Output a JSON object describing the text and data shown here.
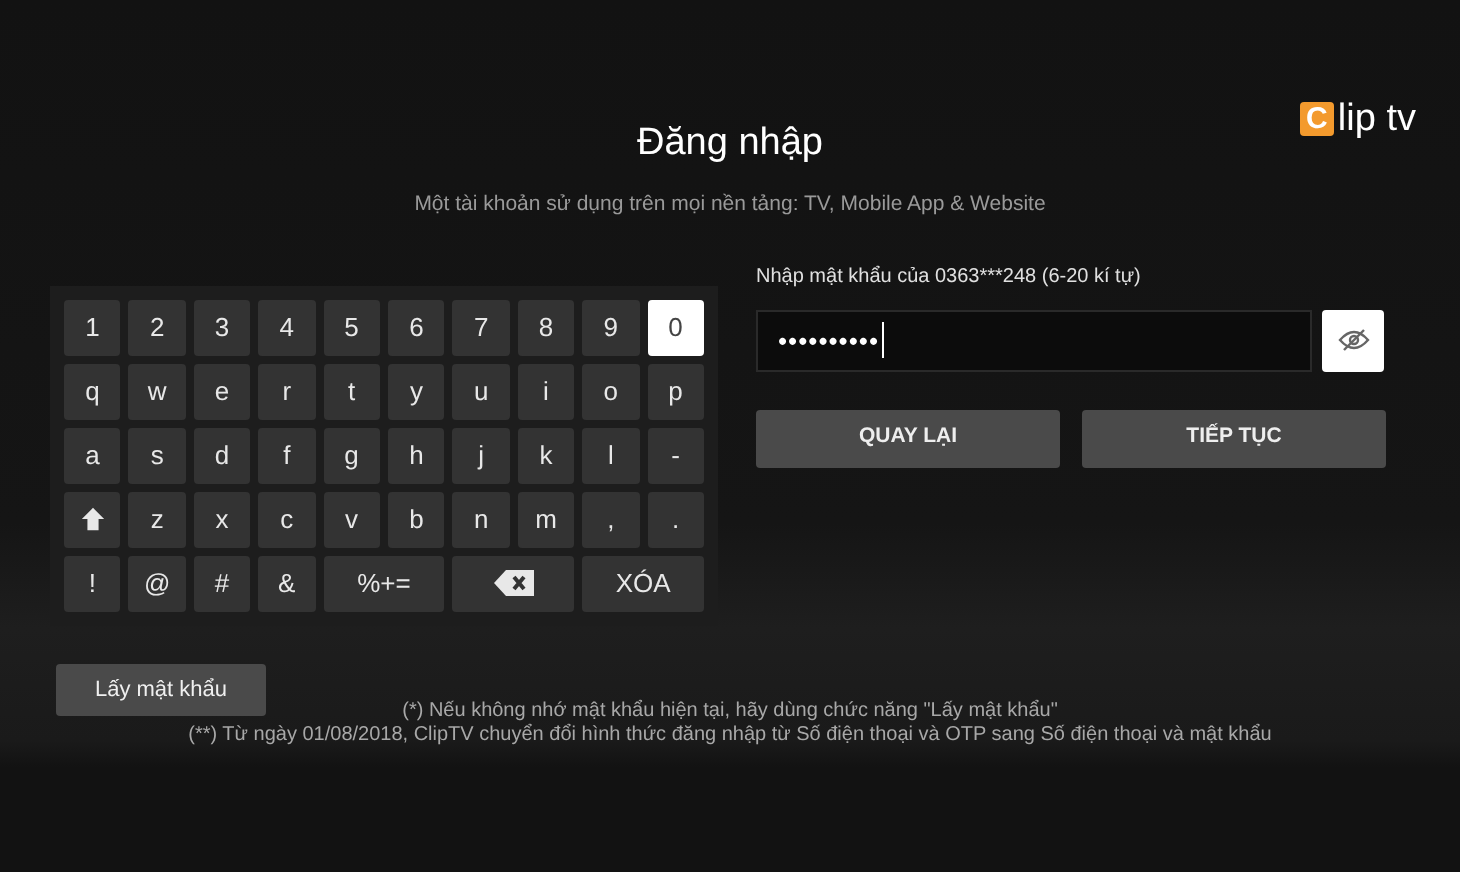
{
  "logo": {
    "badge": "C",
    "text": "lip tv"
  },
  "title": "Đăng nhập",
  "subtitle": "Một tài khoản sử dụng trên mọi nền tảng: TV, Mobile App & Website",
  "keyboard": {
    "rows": [
      [
        {
          "kind": "char",
          "label": "1",
          "selected": false
        },
        {
          "kind": "char",
          "label": "2",
          "selected": false
        },
        {
          "kind": "char",
          "label": "3",
          "selected": false
        },
        {
          "kind": "char",
          "label": "4",
          "selected": false
        },
        {
          "kind": "char",
          "label": "5",
          "selected": false
        },
        {
          "kind": "char",
          "label": "6",
          "selected": false
        },
        {
          "kind": "char",
          "label": "7",
          "selected": false
        },
        {
          "kind": "char",
          "label": "8",
          "selected": false
        },
        {
          "kind": "char",
          "label": "9",
          "selected": false
        },
        {
          "kind": "char",
          "label": "0",
          "selected": true
        }
      ],
      [
        {
          "kind": "char",
          "label": "q",
          "selected": false
        },
        {
          "kind": "char",
          "label": "w",
          "selected": false
        },
        {
          "kind": "char",
          "label": "e",
          "selected": false
        },
        {
          "kind": "char",
          "label": "r",
          "selected": false
        },
        {
          "kind": "char",
          "label": "t",
          "selected": false
        },
        {
          "kind": "char",
          "label": "y",
          "selected": false
        },
        {
          "kind": "char",
          "label": "u",
          "selected": false
        },
        {
          "kind": "char",
          "label": "i",
          "selected": false
        },
        {
          "kind": "char",
          "label": "o",
          "selected": false
        },
        {
          "kind": "char",
          "label": "p",
          "selected": false
        }
      ],
      [
        {
          "kind": "char",
          "label": "a",
          "selected": false
        },
        {
          "kind": "char",
          "label": "s",
          "selected": false
        },
        {
          "kind": "char",
          "label": "d",
          "selected": false
        },
        {
          "kind": "char",
          "label": "f",
          "selected": false
        },
        {
          "kind": "char",
          "label": "g",
          "selected": false
        },
        {
          "kind": "char",
          "label": "h",
          "selected": false
        },
        {
          "kind": "char",
          "label": "j",
          "selected": false
        },
        {
          "kind": "char",
          "label": "k",
          "selected": false
        },
        {
          "kind": "char",
          "label": "l",
          "selected": false
        },
        {
          "kind": "char",
          "label": "-",
          "selected": false
        }
      ],
      [
        {
          "kind": "shift",
          "selected": false
        },
        {
          "kind": "char",
          "label": "z",
          "selected": false
        },
        {
          "kind": "char",
          "label": "x",
          "selected": false
        },
        {
          "kind": "char",
          "label": "c",
          "selected": false
        },
        {
          "kind": "char",
          "label": "v",
          "selected": false
        },
        {
          "kind": "char",
          "label": "b",
          "selected": false
        },
        {
          "kind": "char",
          "label": "n",
          "selected": false
        },
        {
          "kind": "char",
          "label": "m",
          "selected": false
        },
        {
          "kind": "char",
          "label": ",",
          "selected": false
        },
        {
          "kind": "char",
          "label": ".",
          "selected": false
        }
      ],
      [
        {
          "kind": "char",
          "label": "!",
          "selected": false
        },
        {
          "kind": "char",
          "label": "@",
          "selected": false
        },
        {
          "kind": "char",
          "label": "#",
          "selected": false
        },
        {
          "kind": "char",
          "label": "&",
          "selected": false
        },
        {
          "kind": "wide",
          "label": "%+=",
          "selected": false
        },
        {
          "kind": "backspace",
          "selected": false
        },
        {
          "kind": "wide",
          "label": "XÓA",
          "selected": false
        }
      ]
    ]
  },
  "password": {
    "label": "Nhập mật khẩu của 0363***248 (6-20 kí tự)",
    "value": "••••••••••"
  },
  "buttons": [
    "QUAY LẠI",
    "TIẾP TỤC"
  ],
  "forgot_button": "Lấy mật khẩu",
  "notes": [
    "(*) Nếu không nhớ mật khẩu hiện tại, hãy dùng chức năng \"Lấy mật khẩu\"",
    "(**) Từ ngày 01/08/2018, ClipTV chuyển đổi hình thức đăng nhập từ Số điện thoại và OTP sang Số điện thoại và mật khẩu"
  ]
}
